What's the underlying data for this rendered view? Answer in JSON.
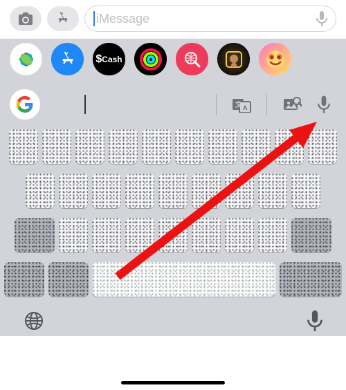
{
  "input_bar": {
    "placeholder": "iMessage"
  },
  "app_strip": {
    "photos": "Photos",
    "app_store": "App Store",
    "cash_symbol": "$",
    "cash_label": "Cash",
    "activity": "Activity",
    "translate": "Translate",
    "memoji": "Memoji",
    "animoji": "Animoji"
  },
  "gboard": {
    "logo_letter": "G",
    "translate_icon": "translate-icon",
    "search_icon": "image-search-icon",
    "mic_icon": "microphone-icon"
  },
  "bottom_bar": {
    "globe": "globe-icon",
    "dictation": "dictation-icon"
  },
  "colors": {
    "accent_blue": "#3478f6",
    "annotation_red": "#e11",
    "keyboard_bg": "#d2d4da"
  }
}
